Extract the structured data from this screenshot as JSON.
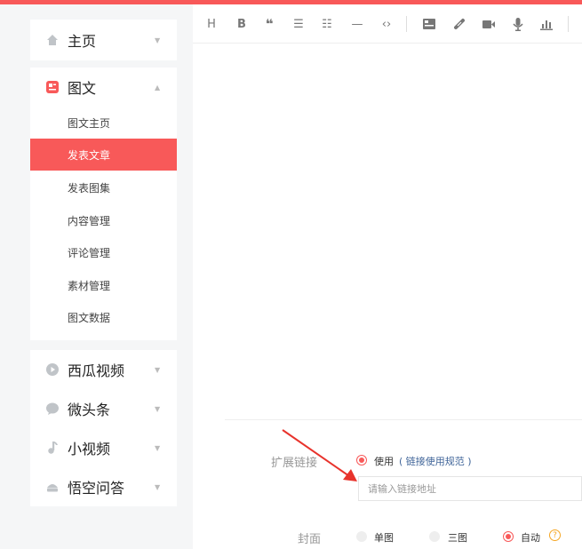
{
  "sidebar": {
    "home": {
      "label": "主页",
      "icon": "home-icon"
    },
    "news": {
      "label": "图文",
      "icon": "article-icon",
      "items": [
        "图文主页",
        "发表文章",
        "发表图集",
        "内容管理",
        "评论管理",
        "素材管理",
        "图文数据"
      ],
      "active_index": 1
    },
    "more": [
      {
        "label": "西瓜视频",
        "icon": "play-icon"
      },
      {
        "label": "微头条",
        "icon": "chat-icon"
      },
      {
        "label": "小视频",
        "icon": "music-note-icon"
      },
      {
        "label": "悟空问答",
        "icon": "qa-icon"
      }
    ]
  },
  "toolbar": {
    "heading": "H",
    "bold": "B",
    "quote": "❝",
    "bullets": "☰",
    "numbered": "☷",
    "hr": "—",
    "code": "‹›"
  },
  "form": {
    "ext_link": {
      "label": "扩展链接",
      "use_label": "使用",
      "rule_link": "( 链接使用规范 )",
      "placeholder": "请输入链接地址"
    },
    "cover": {
      "label": "封面",
      "options": [
        "单图",
        "三图",
        "自动"
      ],
      "selected": "自动"
    }
  },
  "colors": {
    "accent": "#f85959",
    "link": "#406599",
    "help": "#f5a623"
  }
}
